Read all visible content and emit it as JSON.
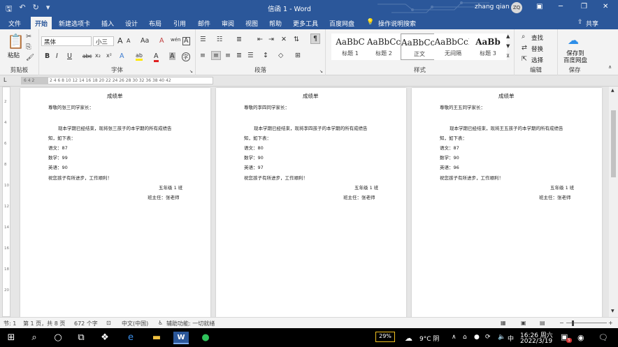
{
  "window": {
    "title": "信函 1  -  Word",
    "user": "zhang qian",
    "user_initials": "ZQ",
    "min": "─",
    "restore": "❐",
    "close": "✕",
    "ribbon_opts": "▣"
  },
  "qa": {
    "save": "🖫",
    "undo": "↶",
    "redo": "↻",
    "more": "▾"
  },
  "tabs": [
    "文件",
    "开始",
    "新建选项卡",
    "插入",
    "设计",
    "布局",
    "引用",
    "邮件",
    "审阅",
    "视图",
    "帮助",
    "更多工具",
    "百度网盘"
  ],
  "tellme": "操作说明搜索",
  "share": "共享",
  "clipboard": {
    "paste": "粘贴",
    "label": "剪贴板"
  },
  "font": {
    "name": "黑体",
    "size": "小三",
    "label": "字体",
    "grow": "A",
    "shrink": "A",
    "case": "Aa",
    "clear": "A",
    "phonetic": "wén",
    "border": "A",
    "bold": "B",
    "italic": "I",
    "underline": "U",
    "strike": "abc",
    "sub": "x₂",
    "sup": "x²",
    "effects": "A",
    "highlight": "ab",
    "color": "A",
    "shade": "A",
    "enclose": "字"
  },
  "paragraph": {
    "label": "段落"
  },
  "styles": {
    "label": "样式",
    "items": [
      {
        "preview": "AaBbC",
        "name": "标题 1"
      },
      {
        "preview": "AaBbCc",
        "name": "标题 2"
      },
      {
        "preview": "AaBbCcI",
        "name": "正文"
      },
      {
        "preview": "AaBbCcI",
        "name": "无间隔"
      },
      {
        "preview": "AaBb",
        "name": "标题 3"
      }
    ]
  },
  "editing": {
    "label": "编辑",
    "find": "查找",
    "replace": "替换",
    "select": "选择"
  },
  "save_group": {
    "button": "保存到\n百度网盘",
    "label": "保存"
  },
  "ruler_text": "2  4  6  8  10  12  14  16  18  20  22  24  26  28  30  32      36  38  40  42",
  "ruler_left": "6  4  2",
  "pages": [
    {
      "title": "成绩单",
      "greeting": "尊敬的张三同学家长：",
      "body1": "现本学期已经结束，现将张三孩子的本学期的所有成绩告",
      "body2": "知，如下表：",
      "chinese": "语文：87",
      "math": "数学：99",
      "english": "英语：90",
      "closing": "祝您孩子有所进步，工作顺利！",
      "class": "五年级 1 班",
      "teacher": "班主任：张老师"
    },
    {
      "title": "成绩单",
      "greeting": "尊敬的李四同学家长：",
      "body1": "现本学期已经结束，现将李四孩子的本学期的所有成绩告",
      "body2": "知，如下表：",
      "chinese": "语文：80",
      "math": "数学：90",
      "english": "英语：97",
      "closing": "祝您孩子有所进步，工作顺利！",
      "class": "五年级 1 班",
      "teacher": "班主任：张老师"
    },
    {
      "title": "成绩单",
      "greeting": "尊敬的王五同学家长：",
      "body1": "现本学期已经结束，现将王五孩子的本学期的所有成绩告",
      "body2": "知，如下表：",
      "chinese": "语文：87",
      "math": "数学：90",
      "english": "英语：96",
      "closing": "祝您孩子有所进步，工作顺利！",
      "class": "五年级 1 班",
      "teacher": "班主任：张老师"
    }
  ],
  "status": {
    "section": "节: 1",
    "page": "第 1 页，共 8 页",
    "words": "672 个字",
    "lang": "中文(中国)",
    "access": "辅助功能: 一切就绪"
  },
  "taskbar": {
    "battery": "29%",
    "weather": "9°C 阴",
    "ime": "中",
    "time": "16:26 周六",
    "date": "2022/3/19",
    "notif": "5"
  }
}
